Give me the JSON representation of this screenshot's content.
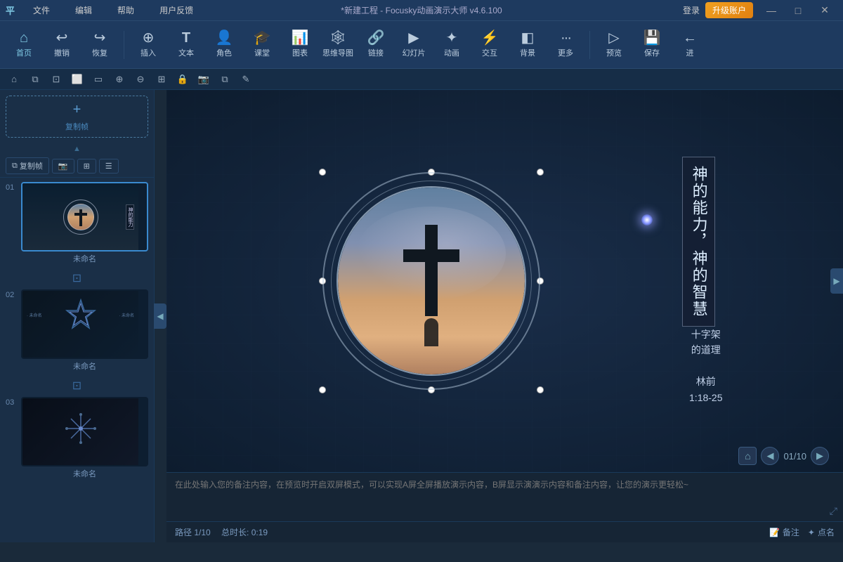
{
  "titlebar": {
    "logo": "平",
    "menus": [
      "文件",
      "编辑",
      "帮助",
      "用户反馈"
    ],
    "title": "*新建工程 - Focusky动画演示大师  v4.6.100",
    "login": "登录",
    "upgrade": "升级账户",
    "win_min": "—",
    "win_max": "□",
    "win_close": "✕"
  },
  "toolbar": {
    "items": [
      {
        "id": "home",
        "icon": "⌂",
        "label": "首页"
      },
      {
        "id": "undo",
        "icon": "↩",
        "label": "撤销"
      },
      {
        "id": "redo",
        "icon": "↪",
        "label": "恢复"
      },
      {
        "id": "sep1"
      },
      {
        "id": "insert",
        "icon": "⊕",
        "label": "插入"
      },
      {
        "id": "text",
        "icon": "T",
        "label": "文本"
      },
      {
        "id": "role",
        "icon": "👤",
        "label": "角色"
      },
      {
        "id": "class",
        "icon": "🎓",
        "label": "课堂"
      },
      {
        "id": "chart",
        "icon": "📊",
        "label": "图表"
      },
      {
        "id": "mind",
        "icon": "🕸",
        "label": "思维导图"
      },
      {
        "id": "link",
        "icon": "🔗",
        "label": "链接"
      },
      {
        "id": "slide",
        "icon": "▶",
        "label": "幻灯片"
      },
      {
        "id": "anim",
        "icon": "✦",
        "label": "动画"
      },
      {
        "id": "inter",
        "icon": "⚡",
        "label": "交互"
      },
      {
        "id": "bg",
        "icon": "◧",
        "label": "背景"
      },
      {
        "id": "more",
        "icon": "···",
        "label": "更多"
      },
      {
        "id": "sep2"
      },
      {
        "id": "preview",
        "icon": "▷",
        "label": "预览"
      },
      {
        "id": "save",
        "icon": "💾",
        "label": "保存"
      },
      {
        "id": "back",
        "icon": "←",
        "label": "进"
      }
    ]
  },
  "slide_actions": {
    "copy": "复制帧",
    "camera": "📷",
    "fit": "⊞",
    "layout": "☰"
  },
  "slides": [
    {
      "num": "01",
      "label": "未命名",
      "type": "cross",
      "selected": true
    },
    {
      "num": "02",
      "label": "未命名",
      "type": "geometric"
    },
    {
      "num": "03",
      "label": "未命名",
      "type": "snowflake"
    }
  ],
  "canvas": {
    "vertical_text": "神的能力，神的智慧",
    "side_text_line1": "十字架",
    "side_text_line2": "的道理",
    "side_text_line3": "",
    "side_text_line4": "林前",
    "side_text_line5": "1:18-25"
  },
  "notes": {
    "placeholder": "在此处输入您的备注内容，在预览时开启双屏模式，可以实现A屏全屏播放演示内容，B屏显示演演示内容和备注内容，让您的演示更轻松~"
  },
  "statusbar": {
    "path": "路径 1/10",
    "duration": "总时长: 0:19",
    "notes_btn": "备注",
    "points_btn": "点名"
  },
  "slide_nav": {
    "current": "01/10",
    "prev": "◀",
    "next": "▶"
  },
  "colors": {
    "accent": "#3a8acf",
    "bg_dark": "#0d1c2e",
    "bg_mid": "#1a2f47",
    "text_light": "#ddeeff",
    "border": "#2a4a6f"
  }
}
